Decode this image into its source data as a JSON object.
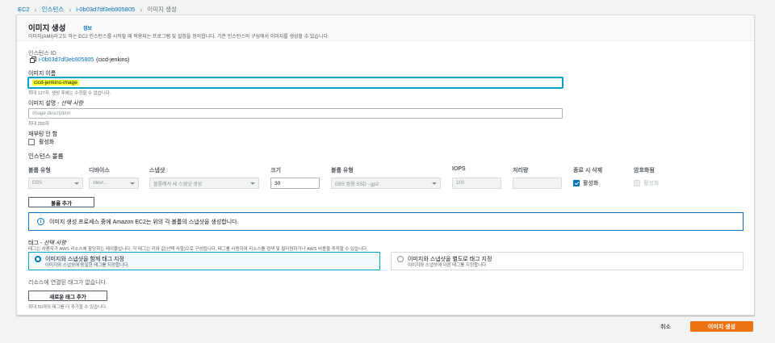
{
  "breadcrumb": [
    "EC2",
    "인스턴스",
    "i-0b03d7df3eb905805",
    "이미지 생성"
  ],
  "header": {
    "title": "이미지 생성",
    "info": "정보",
    "description": "이미지(AMI)라고도 하는 EC2 인스턴스를 시작할 때 적용되는 프로그램 및 설정을 정의합니다. 기존 인스턴스의 구성에서 이미지를 생성할 수 있습니다."
  },
  "instance": {
    "label": "인스턴스 ID",
    "id": "i-0b03d7df3eb905805",
    "name": "(cicd-jenkins)"
  },
  "image_name": {
    "label": "이미지 이름",
    "value": "cicd-jenkins-image",
    "hint": "최대 127자. 생성 후에는 수정할 수 없습니다."
  },
  "image_desc": {
    "label": "이미지 설명 - ",
    "optional": "선택 사항",
    "placeholder": "Image description",
    "hint": "최대 255자"
  },
  "reboot": {
    "label": "재부팅 안 함",
    "checkbox": "활성화"
  },
  "volumes": {
    "title": "인스턴스 볼륨",
    "headers": [
      "볼륨 유형",
      "디바이스",
      "스냅샷",
      "크기",
      "볼륨 유형",
      "IOPS",
      "처리량",
      "종료 시 삭제",
      "암호화됨"
    ],
    "row": {
      "type": "EBS",
      "device": "/dev/...",
      "snapshot": "볼륨에서 새 스냅샷 생성",
      "size": "30",
      "vtype": "EBS 범용 SSD - gp2",
      "iops": "100",
      "throughput": "",
      "delete_on_term": "활성화",
      "encrypted": "활성화"
    },
    "add_button": "볼륨 추가"
  },
  "alert": "이미지 생성 프로세스 중에 Amazon EC2는 위의 각 볼륨의 스냅샷을 생성합니다.",
  "tags": {
    "title": "태그 - ",
    "optional": "선택 사항",
    "desc": "태그는 사용자가 AWS 리소스에 할당하는 레이블입니다. 각 태그는 키와 값(선택 사항)으로 구성됩니다. 태그를 사용하여 리소스를 검색 및 필터링하거나 AWS 비용을 추적할 수 있습니다.",
    "option1_title": "이미지와 스냅샷을 함께 태그 지정",
    "option1_desc": "이미지와 스냅샷에 동일한 태그를 지정합니다.",
    "option2_title": "이미지와 스냅샷을 별도로 태그 지정",
    "option2_desc": "이미지와 스냅샷에 다른 태그를 지정합니다.",
    "empty": "리소스에 연결된 태그가 없습니다.",
    "add_button": "새로운 태그 추가",
    "hint": "최대 50개의 태그를 더 추가할 수 있습니다."
  },
  "footer": {
    "cancel": "취소",
    "create": "이미지 생성"
  }
}
